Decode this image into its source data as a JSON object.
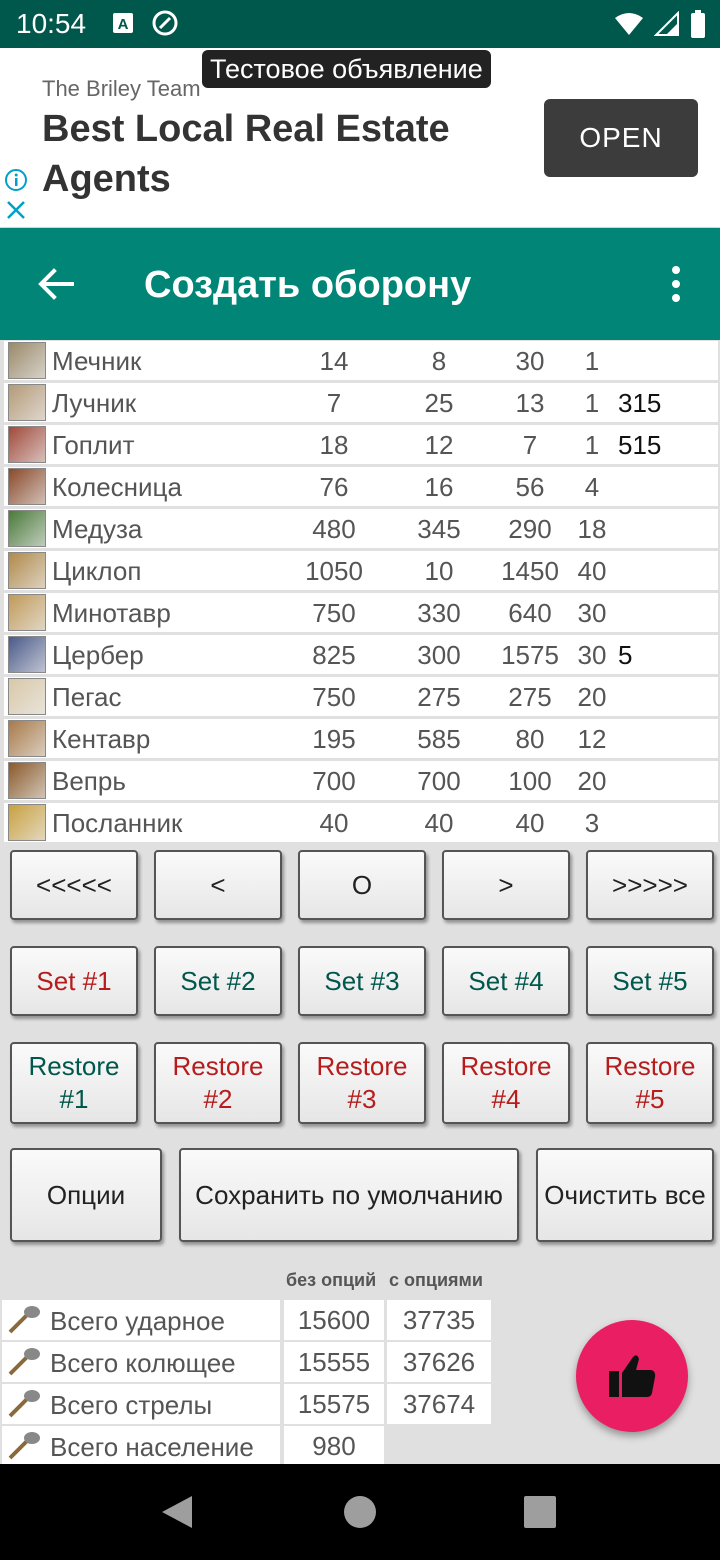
{
  "status": {
    "time": "10:54"
  },
  "ad": {
    "tooltip": "Тестовое объявление",
    "sponsor": "The Briley Team",
    "headline": "Best Local Real Estate Agents",
    "open_label": "OPEN"
  },
  "appbar": {
    "title": "Создать оборону"
  },
  "units": [
    {
      "name": "Мечник",
      "a": "14",
      "b": "8",
      "c": "30",
      "d": "1",
      "e": "",
      "icon": "swordsman-icon",
      "color": "#9a8a6a"
    },
    {
      "name": "Лучник",
      "a": "7",
      "b": "25",
      "c": "13",
      "d": "1",
      "e": "315",
      "icon": "archer-icon",
      "color": "#b49a78"
    },
    {
      "name": "Гоплит",
      "a": "18",
      "b": "12",
      "c": "7",
      "d": "1",
      "e": "515",
      "icon": "hoplite-icon",
      "color": "#a04a3a"
    },
    {
      "name": "Колесница",
      "a": "76",
      "b": "16",
      "c": "56",
      "d": "4",
      "e": "",
      "icon": "chariot-icon",
      "color": "#8a4a2a"
    },
    {
      "name": "Медуза",
      "a": "480",
      "b": "345",
      "c": "290",
      "d": "18",
      "e": "",
      "icon": "medusa-icon",
      "color": "#4a7a3a"
    },
    {
      "name": "Циклоп",
      "a": "1050",
      "b": "10",
      "c": "1450",
      "d": "40",
      "e": "",
      "icon": "cyclops-icon",
      "color": "#b08a4a"
    },
    {
      "name": "Минотавр",
      "a": "750",
      "b": "330",
      "c": "640",
      "d": "30",
      "e": "",
      "icon": "minotaur-icon",
      "color": "#c09a5a"
    },
    {
      "name": "Цербер",
      "a": "825",
      "b": "300",
      "c": "1575",
      "d": "30",
      "e": "5",
      "icon": "cerberus-icon",
      "color": "#4a5a8a"
    },
    {
      "name": "Пегас",
      "a": "750",
      "b": "275",
      "c": "275",
      "d": "20",
      "e": "",
      "icon": "pegasus-icon",
      "color": "#d8c8a8"
    },
    {
      "name": "Кентавр",
      "a": "195",
      "b": "585",
      "c": "80",
      "d": "12",
      "e": "",
      "icon": "centaur-icon",
      "color": "#a87a4a"
    },
    {
      "name": "Вепрь",
      "a": "700",
      "b": "700",
      "c": "100",
      "d": "20",
      "e": "",
      "icon": "boar-icon",
      "color": "#8a5a2a"
    },
    {
      "name": "Посланник",
      "a": "40",
      "b": "40",
      "c": "40",
      "d": "3",
      "e": "",
      "icon": "messenger-icon",
      "color": "#c8a040"
    }
  ],
  "nav_buttons": [
    "<<<<<",
    "<",
    "O",
    ">",
    ">>>>>"
  ],
  "set_buttons": [
    "Set #1",
    "Set #2",
    "Set #3",
    "Set #4",
    "Set #5"
  ],
  "restore_buttons": [
    "Restore #1",
    "Restore #2",
    "Restore #3",
    "Restore #4",
    "Restore #5"
  ],
  "actions": {
    "options": "Опции",
    "save_default": "Сохранить по умолчанию",
    "clear_all": "Очистить все"
  },
  "totals_header": {
    "without": "без опций",
    "with": "с опциями"
  },
  "totals": [
    {
      "label": "Всего ударное",
      "without": "15600",
      "with": "37735",
      "icon": "blunt-weapon-icon"
    },
    {
      "label": "Всего колющее",
      "without": "15555",
      "with": "37626",
      "icon": "pierce-weapon-icon"
    },
    {
      "label": "Всего стрелы",
      "without": "15575",
      "with": "37674",
      "icon": "arrows-icon"
    },
    {
      "label": "Всего население",
      "without": "980",
      "with": "",
      "icon": "population-icon"
    }
  ],
  "colors": {
    "appbar": "#008577",
    "statusbar": "#00574b",
    "fab": "#e91e63",
    "red_text": "#b71c1c",
    "teal_text": "#00574b"
  }
}
